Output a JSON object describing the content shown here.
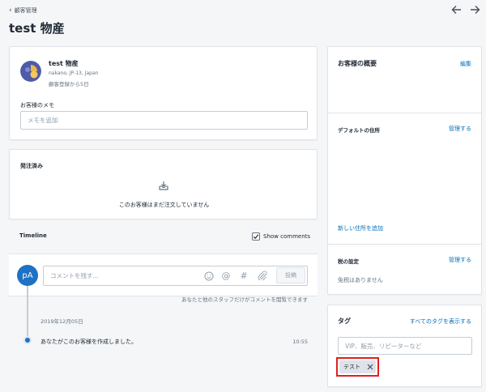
{
  "header": {
    "back_label": "顧客管理",
    "title": "test 物産"
  },
  "customer": {
    "name": "test 物産",
    "location": "nakano, JP-13, Japan",
    "since": "顧客登録から5日",
    "avatar_color": "#4f5aa8"
  },
  "note": {
    "label": "お客様のメモ",
    "placeholder": "メモを追加"
  },
  "orders": {
    "title": "発注済み",
    "empty_text": "このお客様はまだ注文していません"
  },
  "timeline": {
    "title": "Timeline",
    "show_comments_label": "Show comments",
    "show_comments_checked": true,
    "avatar_initials": "pA",
    "avatar_color": "#1d72c4",
    "comment_placeholder": "コメントを残す...",
    "post_label": "投稿",
    "visibility_note": "あなたと他のスタッフだけがコメントを閲覧できます",
    "date": "2019年12月05日",
    "events": [
      {
        "text": "あなたがこのお客様を作成しました。",
        "time": "10:55"
      }
    ]
  },
  "overview": {
    "title": "お客様の概要",
    "edit_label": "編集"
  },
  "address": {
    "title": "デフォルトの住所",
    "manage_label": "管理する",
    "new_address_label": "新しい住所を追加"
  },
  "tax": {
    "title": "税の設定",
    "manage_label": "管理する",
    "status": "免税はありません"
  },
  "tags": {
    "title": "タグ",
    "view_all_label": "すべてのタグを表示する",
    "placeholder": "VIP、販売、リピーターなど",
    "items": [
      {
        "label": "テスト"
      }
    ],
    "highlight_color": "#e02020"
  }
}
